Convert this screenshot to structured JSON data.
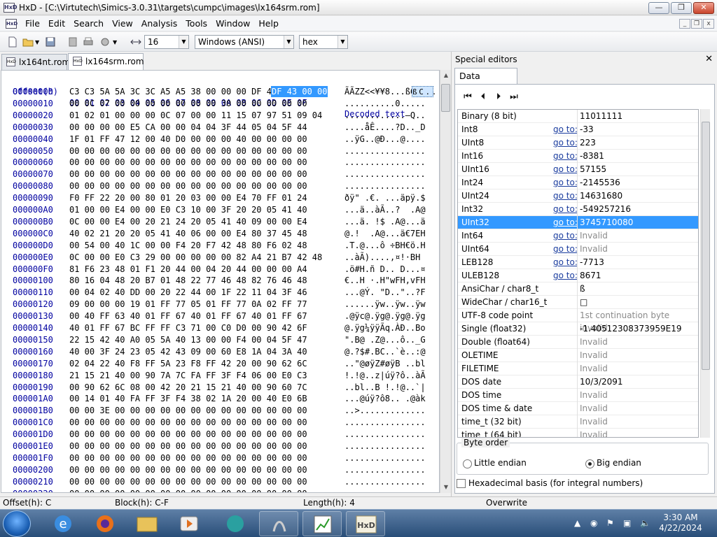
{
  "window": {
    "title": "HxD - [C:\\Virtutech\\Simics-3.0.31\\targets\\cumpc\\images\\lx164srm.rom]"
  },
  "menu": [
    "File",
    "Edit",
    "Search",
    "View",
    "Analysis",
    "Tools",
    "Window",
    "Help"
  ],
  "toolbar": {
    "bytes_per_row": "16",
    "charset": "Windows (ANSI)",
    "display": "hex"
  },
  "tabs": [
    {
      "label": "lx164nt.rom"
    },
    {
      "label": "lx164srm.rom"
    }
  ],
  "hex": {
    "header": {
      "offset_label": "Offset(h)",
      "columns": "00 01 02 03 04 05 06 07 08 09 0A 0B 0C 0D 0E 0F",
      "text_label": "Decoded text"
    },
    "selected_bytes": "DF 43 00 00",
    "selected_text": "ß C . .",
    "rows": [
      {
        "off": "00000000",
        "bytes": "C3 C3 5A 5A 3C 3C A5 A5 38 00 00 00 DF 43 00 00",
        "text": "ÃÃZZ<<¥¥8...ßC.."
      },
      {
        "off": "00000010",
        "bytes": "00 0C 07 00 00 00 00 00 00 00 30 00 00 00 00 00",
        "text": "..........0....."
      },
      {
        "off": "00000020",
        "bytes": "01 02 01 00 00 00 0C 07 00 00 11 15 07 97 51 09 04",
        "text": "............—Q.."
      },
      {
        "off": "00000030",
        "bytes": "00 00 00 00 E5 CA 00 00 04 04 3F 44 05 04 5F 44",
        "text": "....åÊ....?D.._D"
      },
      {
        "off": "00000040",
        "bytes": "1F 01 FF 47 12 00 40 D0 00 00 00 40 00 00 00 00",
        "text": "..ÿG..@Ð...@...."
      },
      {
        "off": "00000050",
        "bytes": "00 00 00 00 00 00 00 00 00 00 00 00 00 00 00 00",
        "text": "................"
      },
      {
        "off": "00000060",
        "bytes": "00 00 00 00 00 00 00 00 00 00 00 00 00 00 00 00",
        "text": "................"
      },
      {
        "off": "00000070",
        "bytes": "00 00 00 00 00 00 00 00 00 00 00 00 00 00 00 00",
        "text": "................"
      },
      {
        "off": "00000080",
        "bytes": "00 00 00 00 00 00 00 00 00 00 00 00 00 00 00 00",
        "text": "................"
      },
      {
        "off": "00000090",
        "bytes": "F0 FF 22 20 00 80 01 20 03 00 00 E4 70 FF 01 24",
        "text": "ðÿ\" .€. ...äpÿ.$"
      },
      {
        "off": "000000A0",
        "bytes": "01 00 00 E4 00 00 E0 C3 10 00 3F 20 20 05 41 40",
        "text": "...ä..àÃ..?  .A@"
      },
      {
        "off": "000000B0",
        "bytes": "0C 00 00 E4 00 20 21 24 20 05 41 40 09 00 00 E4",
        "text": "...ä. !$ .A@...ä"
      },
      {
        "off": "000000C0",
        "bytes": "40 02 21 20 20 05 41 40 06 00 00 E4 80 37 45 48",
        "text": "@.!  .A@...ä€7EH"
      },
      {
        "off": "000000D0",
        "bytes": "00 54 00 40 1C 00 00 F4 20 F7 42 48 80 F6 02 48",
        "text": ".T.@...ô ÷BH€ö.H"
      },
      {
        "off": "000000E0",
        "bytes": "0C 00 00 E0 C3 29 00 00 00 00 00 82 A4 21 B7 42 48",
        "text": "..àÃ)....‚¤!·BH"
      },
      {
        "off": "000000F0",
        "bytes": "81 F6 23 48 01 F1 20 44 00 04 20 44 00 00 00 A4",
        "text": ".ö#H.ñ D.. D...¤"
      },
      {
        "off": "00000100",
        "bytes": "80 16 04 48 20 B7 01 48 22 77 46 48 82 76 46 48",
        "text": "€..H ·.H\"wFH‚vFH"
      },
      {
        "off": "00000110",
        "bytes": "00 04 02 40 DD 00 20 22 44 00 1F 22 11 04 3F 46",
        "text": "...@Ý. \"D..\"..?F"
      },
      {
        "off": "00000120",
        "bytes": "09 00 00 00 19 01 FF 77 05 01 FF 77 0A 02 FF 77",
        "text": "......ÿw..ÿw..ÿw"
      },
      {
        "off": "00000130",
        "bytes": "00 40 FF 63 40 01 FF 67 40 01 FF 67 40 01 FF 67",
        "text": ".@ÿc@.ÿg@.ÿg@.ÿg"
      },
      {
        "off": "00000140",
        "bytes": "40 01 FF 67 BC FF FF C3 71 00 C0 D0 00 90 42 6F",
        "text": "@.ÿg¼ÿÿÃq.ÀÐ..Bo"
      },
      {
        "off": "00000150",
        "bytes": "22 15 42 40 A0 05 5A 40 13 00 00 F4 00 04 5F 47",
        "text": "\".B@ .Z@...ô.._G"
      },
      {
        "off": "00000160",
        "bytes": "40 00 3F 24 23 05 42 43 09 00 60 E8 1A 04 3A 40",
        "text": "@.?$#.BC..`è..:@"
      },
      {
        "off": "00000170",
        "bytes": "02 04 22 40 F8 FF 5A 23 F8 FF 42 20 00 90 62 6C",
        "text": "..\"@øÿZ#øÿB ..bl"
      },
      {
        "off": "00000180",
        "bytes": "21 15 21 40 00 90 7A 7C FA FF 3F F4 06 00 E0 C3",
        "text": "!.!@..z|úÿ?ô..àÃ"
      },
      {
        "off": "00000190",
        "bytes": "00 90 62 6C 08 00 42 20 21 15 21 40 00 90 60 7C",
        "text": "..bl..B !.!@..`|"
      },
      {
        "off": "000001A0",
        "bytes": "00 14 01 40 FA FF 3F F4 38 02 1A 20 00 40 E0 6B",
        "text": "...@úÿ?ô8.. .@àk"
      },
      {
        "off": "000001B0",
        "bytes": "00 00 3E 00 00 00 00 00 00 00 00 00 00 00 00 00",
        "text": "..>............."
      },
      {
        "off": "000001C0",
        "bytes": "00 00 00 00 00 00 00 00 00 00 00 00 00 00 00 00",
        "text": "................"
      },
      {
        "off": "000001D0",
        "bytes": "00 00 00 00 00 00 00 00 00 00 00 00 00 00 00 00",
        "text": "................"
      },
      {
        "off": "000001E0",
        "bytes": "00 00 00 00 00 00 00 00 00 00 00 00 00 00 00 00",
        "text": "................"
      },
      {
        "off": "000001F0",
        "bytes": "00 00 00 00 00 00 00 00 00 00 00 00 00 00 00 00",
        "text": "................"
      },
      {
        "off": "00000200",
        "bytes": "00 00 00 00 00 00 00 00 00 00 00 00 00 00 00 00",
        "text": "................"
      },
      {
        "off": "00000210",
        "bytes": "00 00 00 00 00 00 00 00 00 00 00 00 00 00 00 00",
        "text": "................"
      },
      {
        "off": "00000220",
        "bytes": "00 00 00 00 00 00 00 00 00 00 00 00 00 00 00 00",
        "text": "................"
      },
      {
        "off": "00000230",
        "bytes": "00 00 00 00 00 00 00 00 48 01 08 75 49 01 29 75",
        "text": "........H..uI.)u"
      }
    ]
  },
  "side": {
    "header": "Special editors",
    "tab": "Data inspector",
    "goto_label": "go to:",
    "rows": [
      {
        "name": "Binary (8 bit)",
        "goto": false,
        "value": "11011111"
      },
      {
        "name": "Int8",
        "goto": true,
        "value": "-33"
      },
      {
        "name": "UInt8",
        "goto": true,
        "value": "223"
      },
      {
        "name": "Int16",
        "goto": true,
        "value": "-8381"
      },
      {
        "name": "UInt16",
        "goto": true,
        "value": "57155"
      },
      {
        "name": "Int24",
        "goto": true,
        "value": "-2145536"
      },
      {
        "name": "UInt24",
        "goto": true,
        "value": "14631680"
      },
      {
        "name": "Int32",
        "goto": true,
        "value": "-549257216"
      },
      {
        "name": "UInt32",
        "goto": true,
        "value": "3745710080",
        "highlight": true
      },
      {
        "name": "Int64",
        "goto": true,
        "value": "Invalid",
        "invalid": true
      },
      {
        "name": "UInt64",
        "goto": true,
        "value": "Invalid",
        "invalid": true
      },
      {
        "name": "LEB128",
        "goto": true,
        "value": "-7713"
      },
      {
        "name": "ULEB128",
        "goto": true,
        "value": "8671"
      },
      {
        "name": "AnsiChar / char8_t",
        "goto": false,
        "value": "ß"
      },
      {
        "name": "WideChar / char16_t",
        "goto": false,
        "value": "□"
      },
      {
        "name": "UTF-8 code point",
        "goto": false,
        "value": "1st continuation byte invalid",
        "invalid": true
      },
      {
        "name": "Single (float32)",
        "goto": false,
        "value": "-1.40512308373959E19"
      },
      {
        "name": "Double (float64)",
        "goto": false,
        "value": "Invalid",
        "invalid": true
      },
      {
        "name": "OLETIME",
        "goto": false,
        "value": "Invalid",
        "invalid": true
      },
      {
        "name": "FILETIME",
        "goto": false,
        "value": "Invalid",
        "invalid": true
      },
      {
        "name": "DOS date",
        "goto": false,
        "value": "10/3/2091"
      },
      {
        "name": "DOS time",
        "goto": false,
        "value": "Invalid",
        "invalid": true
      },
      {
        "name": "DOS time & date",
        "goto": false,
        "value": "Invalid",
        "invalid": true
      },
      {
        "name": "time_t (32 bit)",
        "goto": false,
        "value": "Invalid",
        "invalid": true
      },
      {
        "name": "time_t (64 bit)",
        "goto": false,
        "value": "Invalid",
        "invalid": true
      }
    ],
    "byte_order": {
      "label": "Byte order",
      "little": "Little endian",
      "big": "Big endian",
      "selected": "big"
    },
    "hex_basis": "Hexadecimal basis (for integral numbers)"
  },
  "status": {
    "offset": "Offset(h): C",
    "block": "Block(h): C-F",
    "length": "Length(h): 4",
    "mode": "Overwrite"
  },
  "taskbar": {
    "time": "3:30 AM",
    "date": "4/22/2024"
  },
  "colors": {
    "selection": "#3399ff",
    "link": "#1a3c9e",
    "offset_text": "#0000a0",
    "invalid_text": "#8a8a8a"
  }
}
